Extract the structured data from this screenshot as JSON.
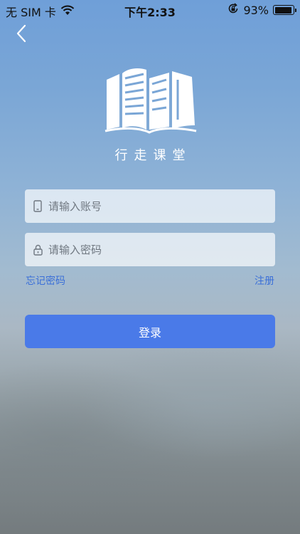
{
  "status_bar": {
    "carrier": "无 SIM 卡",
    "time": "下午2:33",
    "battery_percent": "93%",
    "battery_level": 0.93,
    "icons": [
      "wifi-icon",
      "rotation-lock-icon",
      "battery-icon"
    ]
  },
  "nav": {
    "back_icon": "chevron-left-icon"
  },
  "app": {
    "name": "行走课堂",
    "logo": "book-building-logo"
  },
  "form": {
    "username_placeholder": "请输入账号",
    "username_value": "",
    "username_icon": "phone-icon",
    "password_placeholder": "请输入密码",
    "password_value": "",
    "password_icon": "lock-icon",
    "forgot_label": "忘记密码",
    "register_label": "注册",
    "login_label": "登录"
  },
  "colors": {
    "primary": "#4a7ae8",
    "link": "#3a6fd8",
    "background_top": "#6f9fd8"
  }
}
